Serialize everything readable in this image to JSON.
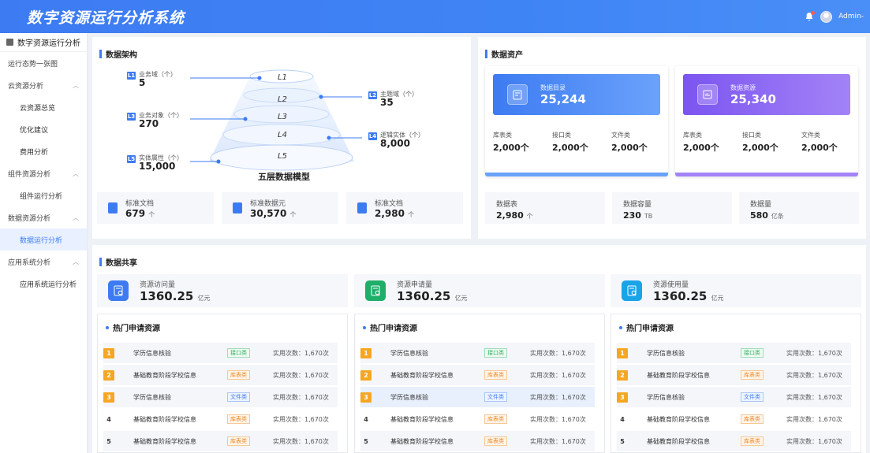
{
  "app": {
    "title": "数字资源运行分析系统",
    "user": "Admin-"
  },
  "sidebar": {
    "header": "数字资源运行分析",
    "items": [
      {
        "label": "运行态势一张图",
        "sub": false,
        "chevron": false,
        "active": false
      },
      {
        "label": "云资源分析",
        "sub": false,
        "chevron": true,
        "active": false
      },
      {
        "label": "云资源总览",
        "sub": true,
        "chevron": false,
        "active": false
      },
      {
        "label": "优化建议",
        "sub": true,
        "chevron": false,
        "active": false
      },
      {
        "label": "费用分析",
        "sub": true,
        "chevron": false,
        "active": false
      },
      {
        "label": "组件资源分析",
        "sub": false,
        "chevron": true,
        "active": false
      },
      {
        "label": "组件运行分析",
        "sub": true,
        "chevron": false,
        "active": false
      },
      {
        "label": "数据资源分析",
        "sub": false,
        "chevron": true,
        "active": false
      },
      {
        "label": "数据运行分析",
        "sub": true,
        "chevron": false,
        "active": true
      },
      {
        "label": "应用系统分析",
        "sub": false,
        "chevron": true,
        "active": false
      },
      {
        "label": "应用系统运行分析",
        "sub": true,
        "chevron": false,
        "active": false
      }
    ]
  },
  "architecture": {
    "title": "数据架构",
    "model_label": "五层数据模型",
    "layers": [
      {
        "badge": "L1",
        "name": "业务域（个）",
        "value": "5",
        "layer": "L1"
      },
      {
        "badge": "L2",
        "name": "主题域（个）",
        "value": "35",
        "layer": "L2"
      },
      {
        "badge": "L3",
        "name": "业务对象（个）",
        "value": "270",
        "layer": "L3"
      },
      {
        "badge": "L4",
        "name": "逻辑实体（个）",
        "value": "8,000",
        "layer": "L4"
      },
      {
        "badge": "L5",
        "name": "实体属性（个）",
        "value": "15,000",
        "layer": "L5"
      }
    ],
    "stats": [
      {
        "name": "标准文档",
        "value": "679",
        "unit": "个",
        "color": "#3d7bf2"
      },
      {
        "name": "标准数据元",
        "value": "30,570",
        "unit": "个",
        "color": "#3d7bf2"
      },
      {
        "name": "标准文档",
        "value": "2,980",
        "unit": "个",
        "color": "#3d7bf2"
      }
    ]
  },
  "assets": {
    "title": "数据资产",
    "cards": [
      {
        "name": "数据目录",
        "value": "25,244",
        "color": "#3d7bf2",
        "subs": [
          {
            "name": "库表类",
            "value": "2,000个"
          },
          {
            "name": "接口类",
            "value": "2,000个"
          },
          {
            "name": "文件类",
            "value": "2,000个"
          }
        ]
      },
      {
        "name": "数据资源",
        "value": "25,340",
        "color": "#7b55f0",
        "subs": [
          {
            "name": "库表类",
            "value": "2,000个"
          },
          {
            "name": "接口类",
            "value": "2,000个"
          },
          {
            "name": "文件类",
            "value": "2,000个"
          }
        ]
      }
    ],
    "stats": [
      {
        "name": "数据表",
        "value": "2,980",
        "unit": "个"
      },
      {
        "name": "数据容量",
        "value": "230",
        "unit": "TB"
      },
      {
        "name": "数据量",
        "value": "580",
        "unit": "亿条"
      }
    ]
  },
  "share": {
    "title": "数据共享",
    "stats": [
      {
        "name": "资源访问量",
        "value": "1360.25",
        "unit": "亿元",
        "color": "#3d7bf2"
      },
      {
        "name": "资源申请量",
        "value": "1360.25",
        "unit": "亿元",
        "color": "#1fae6a"
      },
      {
        "name": "资源使用量",
        "value": "1360.25",
        "unit": "亿元",
        "color": "#1aa4e8"
      }
    ],
    "hot_title": "热门申请资源",
    "rows": [
      {
        "rank": "1",
        "name": "学历信息核验",
        "tag": "接口类",
        "tag_type": "api",
        "count": "实用次数：1,670次"
      },
      {
        "rank": "2",
        "name": "基础教育阶段学校信息",
        "tag": "库表类",
        "tag_type": "db",
        "count": "实用次数：1,670次"
      },
      {
        "rank": "3",
        "name": "学历信息核验",
        "tag": "文件类",
        "tag_type": "file",
        "count": "实用次数：1,670次"
      },
      {
        "rank": "4",
        "name": "基础教育阶段学校信息",
        "tag": "库表类",
        "tag_type": "db",
        "count": "实用次数：1,670次"
      },
      {
        "rank": "5",
        "name": "基础教育阶段学校信息",
        "tag": "库表类",
        "tag_type": "db",
        "count": "实用次数：1,670次"
      }
    ]
  }
}
